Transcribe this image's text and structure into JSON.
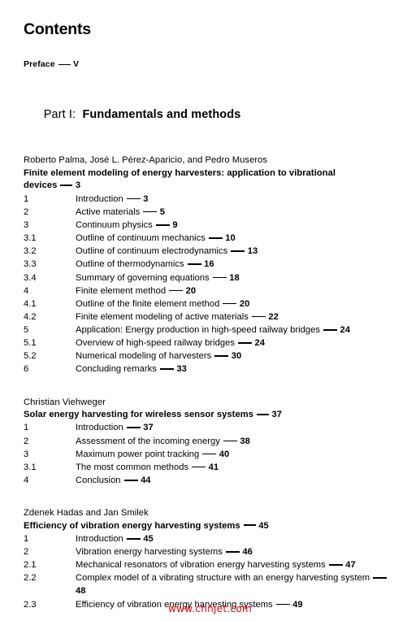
{
  "page": {
    "title": "Contents",
    "watermark": "www.chnjet.com",
    "watermark_color": "#e8000d",
    "text_color": "#000000",
    "background_color": "#ffffff"
  },
  "preface": {
    "label": "Preface",
    "page": "V"
  },
  "part": {
    "label": "Part I:",
    "name": "Fundamentals and methods"
  },
  "chapters": [
    {
      "authors": "Roberto Palma, José L. Pérez-Aparicio, and Pedro Museros",
      "title": "Finite element modeling of energy harvesters: application to vibrational devices",
      "page": "3",
      "entries": [
        {
          "num": "1",
          "text": "Introduction",
          "page": "3"
        },
        {
          "num": "2",
          "text": "Active materials",
          "page": "5"
        },
        {
          "num": "3",
          "text": "Continuum physics",
          "page": "9"
        },
        {
          "num": "3.1",
          "text": "Outline of continuum mechanics",
          "page": "10"
        },
        {
          "num": "3.2",
          "text": "Outline of continuum electrodynamics",
          "page": "13"
        },
        {
          "num": "3.3",
          "text": "Outline of thermodynamics",
          "page": "16"
        },
        {
          "num": "3.4",
          "text": "Summary of governing equations",
          "page": "18"
        },
        {
          "num": "4",
          "text": "Finite element method",
          "page": "20"
        },
        {
          "num": "4.1",
          "text": "Outline of the finite element method",
          "page": "20"
        },
        {
          "num": "4.2",
          "text": "Finite element modeling of active materials",
          "page": "22"
        },
        {
          "num": "5",
          "text": "Application: Energy production in high-speed railway bridges",
          "page": "24"
        },
        {
          "num": "5.1",
          "text": "Overview of high-speed railway bridges",
          "page": "24"
        },
        {
          "num": "5.2",
          "text": "Numerical modeling of harvesters",
          "page": "30"
        },
        {
          "num": "6",
          "text": "Concluding remarks",
          "page": "33"
        }
      ]
    },
    {
      "authors": "Christian Viehweger",
      "title": "Solar energy harvesting for wireless sensor systems",
      "page": "37",
      "entries": [
        {
          "num": "1",
          "text": "Introduction",
          "page": "37"
        },
        {
          "num": "2",
          "text": "Assessment of the incoming energy",
          "page": "38"
        },
        {
          "num": "3",
          "text": "Maximum power point tracking",
          "page": "40"
        },
        {
          "num": "3.1",
          "text": "The most common methods",
          "page": "41"
        },
        {
          "num": "4",
          "text": "Conclusion",
          "page": "44"
        }
      ]
    },
    {
      "authors": "Zdenek Hadas and Jan Smilek",
      "title": "Efficiency of vibration energy harvesting systems",
      "page": "45",
      "entries": [
        {
          "num": "1",
          "text": "Introduction",
          "page": "45"
        },
        {
          "num": "2",
          "text": "Vibration energy harvesting systems",
          "page": "46"
        },
        {
          "num": "2.1",
          "text": "Mechanical resonators of vibration energy harvesting systems",
          "page": "47"
        },
        {
          "num": "2.2",
          "text": "Complex model of a vibrating structure with an energy harvesting system",
          "page": "48"
        },
        {
          "num": "2.3",
          "text": "Efficiency of vibration energy harvesting systems",
          "page": "49"
        }
      ]
    }
  ]
}
